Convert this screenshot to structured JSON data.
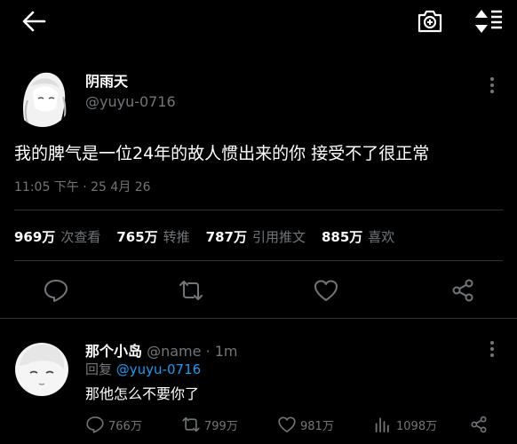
{
  "topbar": {
    "back_icon": "arrow-left-icon",
    "camera_icon": "camera-plus-icon",
    "sort_icon": "sort-updown-icon"
  },
  "tweet": {
    "display_name": "阴雨天",
    "handle": "@yuyu-0716",
    "text": "我的脾气是一位24年的故人惯出来的你 接受不了很正常",
    "timestamp": "11:05 下午 · 25 4月 26",
    "stats": [
      {
        "count": "969万",
        "label": "次查看"
      },
      {
        "count": "765万",
        "label": "转推"
      },
      {
        "count": "787万",
        "label": "引用推文"
      },
      {
        "count": "885万",
        "label": "喜欢"
      }
    ],
    "actions": {
      "reply_icon": "reply-icon",
      "retweet_icon": "retweet-icon",
      "like_icon": "heart-icon",
      "share_icon": "share-icon"
    }
  },
  "reply": {
    "display_name": "那个小岛",
    "handle": "@name",
    "time": "· 1m",
    "replying_prefix": "回复",
    "replying_to": "@yuyu-0716",
    "text": "那他怎么不要你了",
    "counts": {
      "replies": "766万",
      "retweets": "799万",
      "likes": "981万",
      "views": "1098万"
    }
  },
  "colors": {
    "background": "#000000",
    "text": "#e7e9ea",
    "muted": "#71767b",
    "link": "#1d9bf0",
    "divider": "#2f3336"
  }
}
